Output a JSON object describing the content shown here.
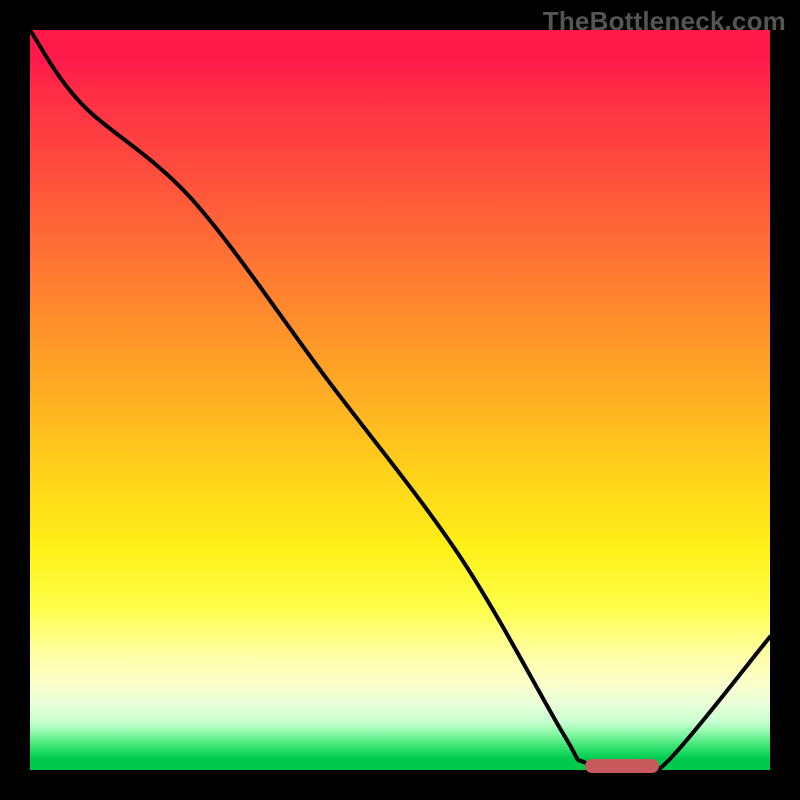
{
  "watermark": "TheBottleneck.com",
  "colors": {
    "curve": "#000000",
    "marker": "#c85a5e",
    "frame": "#000000"
  },
  "chart_data": {
    "type": "line",
    "title": "",
    "xlabel": "",
    "ylabel": "",
    "xlim": [
      0,
      100
    ],
    "ylim": [
      0,
      100
    ],
    "x": [
      0,
      7,
      22,
      40,
      58,
      72,
      75,
      82,
      86,
      100
    ],
    "values": [
      100,
      90,
      77,
      53,
      29,
      5,
      1,
      0.5,
      1,
      18
    ],
    "marker": {
      "x_start": 75,
      "x_end": 85,
      "y": 0.5
    },
    "background_gradient": [
      {
        "pos": 0,
        "color": "#ff1a4a"
      },
      {
        "pos": 0.18,
        "color": "#ff4a3f"
      },
      {
        "pos": 0.38,
        "color": "#ff8a2d"
      },
      {
        "pos": 0.6,
        "color": "#ffd21a"
      },
      {
        "pos": 0.78,
        "color": "#ffff4a"
      },
      {
        "pos": 0.91,
        "color": "#eaffda"
      },
      {
        "pos": 1.0,
        "color": "#00c94e"
      }
    ]
  }
}
